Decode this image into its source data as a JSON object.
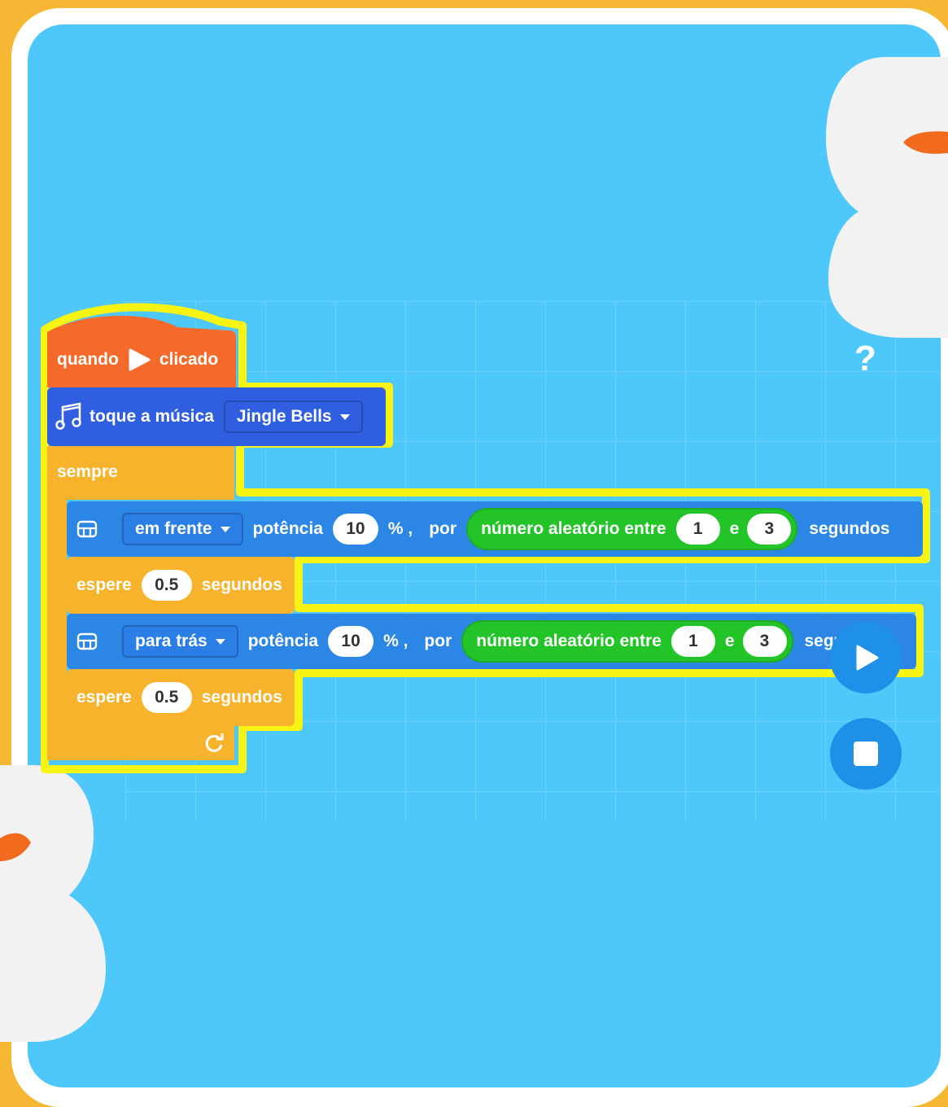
{
  "help": {
    "label": "?"
  },
  "hat": {
    "word1": "quando",
    "word2": "clicado"
  },
  "music": {
    "label": "toque a música",
    "song": "Jingle Bells"
  },
  "loop": {
    "label": "sempre"
  },
  "move1": {
    "direction": "em frente",
    "power_label": "potência",
    "power": "10",
    "percent": "% ,",
    "por": "por",
    "random_label": "número aleatório entre",
    "min": "1",
    "e": "e",
    "max": "3",
    "unit": "segundos"
  },
  "wait1": {
    "label": "espere",
    "value": "0.5",
    "unit": "segundos"
  },
  "move2": {
    "direction": "para trás",
    "power_label": "potência",
    "power": "10",
    "percent": "% ,",
    "por": "por",
    "random_label": "número aleatório entre",
    "min": "1",
    "e": "e",
    "max": "3",
    "unit": "segundos"
  },
  "wait2": {
    "label": "espere",
    "value": "0.5",
    "unit": "segundos"
  },
  "colors": {
    "background_outer": "#f6b735",
    "canvas": "#4ec8fb",
    "event_block": "#f56a2a",
    "music_block": "#2f5fe0",
    "control_block": "#f7b32b",
    "motion_block": "#2b86e6",
    "operator_block": "#22c428",
    "glow": "#f7f313"
  }
}
